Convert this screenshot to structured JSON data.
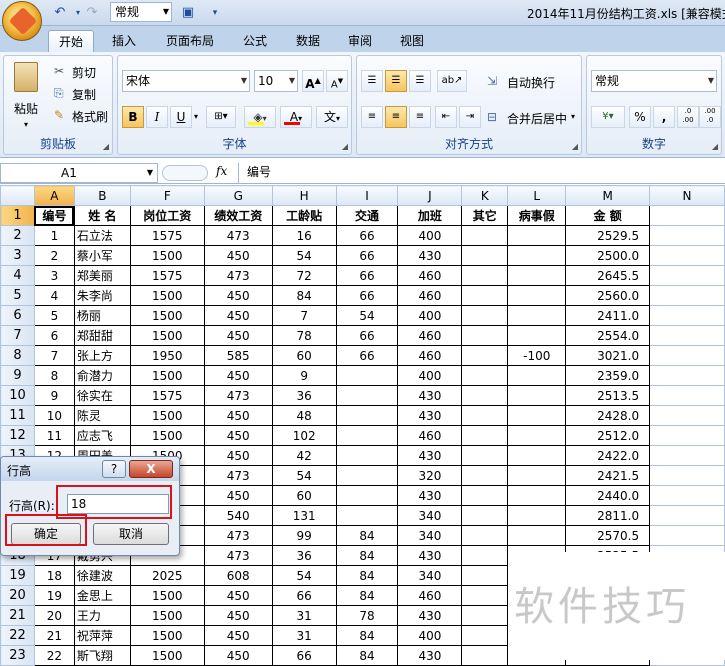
{
  "window": {
    "title": "2014年11月份结构工资.xls  [兼容模式]",
    "qat_format": "常规"
  },
  "tabs": [
    "开始",
    "插入",
    "页面布局",
    "公式",
    "数据",
    "审阅",
    "视图"
  ],
  "ribbon": {
    "clipboard": {
      "paste": "粘贴",
      "cut": "剪切",
      "copy": "复制",
      "format_painter": "格式刷",
      "label": "剪贴板"
    },
    "font": {
      "name": "宋体",
      "size": "10",
      "label": "字体",
      "bold": "B",
      "italic": "I",
      "underline": "U",
      "font_color": "A",
      "phonetic": "文"
    },
    "alignment": {
      "wrap": "自动换行",
      "merge": "合并后居中",
      "label": "对齐方式"
    },
    "number": {
      "format": "常规",
      "label": "数字",
      "percent": "%",
      "comma": ",",
      "inc": ".0\n.00",
      "dec": ".00\n.0"
    }
  },
  "formula_bar": {
    "cell_ref": "A1",
    "fx": "fx",
    "content": "编号"
  },
  "sheet": {
    "columns": [
      "A",
      "B",
      "F",
      "G",
      "H",
      "I",
      "J",
      "K",
      "L",
      "M",
      "N"
    ],
    "header_row": [
      "编号",
      "姓 名",
      "岗位工资",
      "绩效工资",
      "工龄贴",
      "交通",
      "加班",
      "其它",
      "病事假",
      "金 额",
      ""
    ],
    "rows": [
      [
        "1",
        "石立法",
        "1575",
        "473",
        "16",
        "66",
        "400",
        "",
        "",
        "2529.5"
      ],
      [
        "2",
        "蔡小军",
        "1500",
        "450",
        "54",
        "66",
        "430",
        "",
        "",
        "2500.0"
      ],
      [
        "3",
        "郑美丽",
        "1575",
        "473",
        "72",
        "66",
        "460",
        "",
        "",
        "2645.5"
      ],
      [
        "4",
        "朱李尚",
        "1500",
        "450",
        "84",
        "66",
        "460",
        "",
        "",
        "2560.0"
      ],
      [
        "5",
        "杨丽",
        "1500",
        "450",
        "7",
        "54",
        "400",
        "",
        "",
        "2411.0"
      ],
      [
        "6",
        "郑甜甜",
        "1500",
        "450",
        "78",
        "66",
        "460",
        "",
        "",
        "2554.0"
      ],
      [
        "7",
        "张上方",
        "1950",
        "585",
        "60",
        "66",
        "460",
        "",
        "-100",
        "3021.0"
      ],
      [
        "8",
        "俞潜力",
        "1500",
        "450",
        "9",
        "",
        "400",
        "",
        "",
        "2359.0"
      ],
      [
        "9",
        "徐实在",
        "1575",
        "473",
        "36",
        "",
        "430",
        "",
        "",
        "2513.5"
      ],
      [
        "10",
        "陈灵",
        "1500",
        "450",
        "48",
        "",
        "430",
        "",
        "",
        "2428.0"
      ],
      [
        "11",
        "应志飞",
        "1500",
        "450",
        "102",
        "",
        "460",
        "",
        "",
        "2512.0"
      ],
      [
        "12",
        "周田美",
        "1500",
        "450",
        "42",
        "",
        "430",
        "",
        "",
        "2422.0"
      ],
      [
        "13",
        "",
        "",
        "473",
        "54",
        "",
        "320",
        "",
        "",
        "2421.5"
      ],
      [
        "14",
        "",
        "",
        "450",
        "60",
        "",
        "430",
        "",
        "",
        "2440.0"
      ],
      [
        "15",
        "",
        "",
        "540",
        "131",
        "",
        "340",
        "",
        "",
        "2811.0"
      ],
      [
        "16",
        "",
        "",
        "473",
        "99",
        "84",
        "340",
        "",
        "",
        "2570.5"
      ],
      [
        "17",
        "戴勇兴",
        "",
        "473",
        "36",
        "84",
        "430",
        "",
        "",
        "2525.5"
      ],
      [
        "18",
        "徐建波",
        "2025",
        "608",
        "54",
        "84",
        "340",
        "",
        "",
        ""
      ],
      [
        "19",
        "金思上",
        "1500",
        "450",
        "66",
        "84",
        "460",
        "",
        "",
        ""
      ],
      [
        "20",
        "王力",
        "1500",
        "450",
        "31",
        "78",
        "430",
        "",
        "",
        ""
      ],
      [
        "21",
        "祝萍萍",
        "1500",
        "450",
        "31",
        "84",
        "400",
        "",
        "",
        ""
      ],
      [
        "22",
        "斯飞翔",
        "1500",
        "450",
        "66",
        "84",
        "430",
        "",
        "",
        ""
      ]
    ]
  },
  "dialog": {
    "title": "行高",
    "help": "?",
    "close": "X",
    "label": "行高(R):",
    "value": "18",
    "ok": "确定",
    "cancel": "取消"
  },
  "watermark": "软件技巧",
  "colors": {
    "highlight": "#d8141a",
    "selected_header": "#f3b14c",
    "ribbon_bg": "#dfe8f4"
  }
}
